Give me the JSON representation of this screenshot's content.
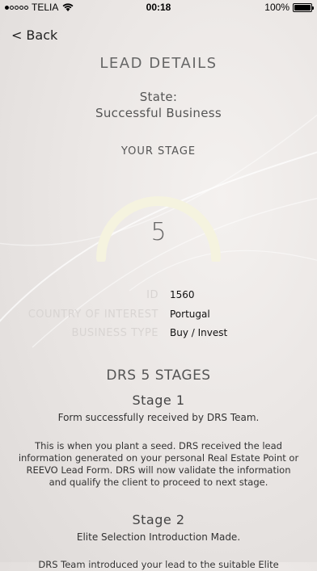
{
  "status_bar": {
    "carrier": "TELIA",
    "time": "00:18",
    "battery_percent": "100%",
    "signal_bars_filled": 1,
    "signal_bars_total": 5
  },
  "nav": {
    "back_label": "Back"
  },
  "header": {
    "title": "LEAD DETAILS",
    "state_label": "State:",
    "state_value": "Successful Business"
  },
  "stage": {
    "label": "YOUR STAGE",
    "value": "5",
    "current": 5,
    "total": 5
  },
  "details": [
    {
      "label": "ID",
      "value": "1560"
    },
    {
      "label": "COUNTRY OF INTEREST",
      "value": "Portugal"
    },
    {
      "label": "BUSINESS TYPE",
      "value": "Buy / Invest"
    }
  ],
  "stages_section": {
    "title": "DRS 5 STAGES",
    "stages": [
      {
        "heading": "Stage 1",
        "subtitle": "Form successfully received by DRS Team.",
        "description": "This is when you plant a seed. DRS received the lead information generated on your personal Real Estate Point or REEVO Lead Form. DRS will now validate the information and qualify the client to proceed to next stage."
      },
      {
        "heading": "Stage 2",
        "subtitle": "Elite Selection Introduction Made.",
        "description": "DRS Team introduced your lead to the suitable Elite"
      }
    ]
  },
  "colors": {
    "gauge_arc": "#f5f3df",
    "label_muted": "#d8d4d2",
    "text_dark": "#111111"
  }
}
